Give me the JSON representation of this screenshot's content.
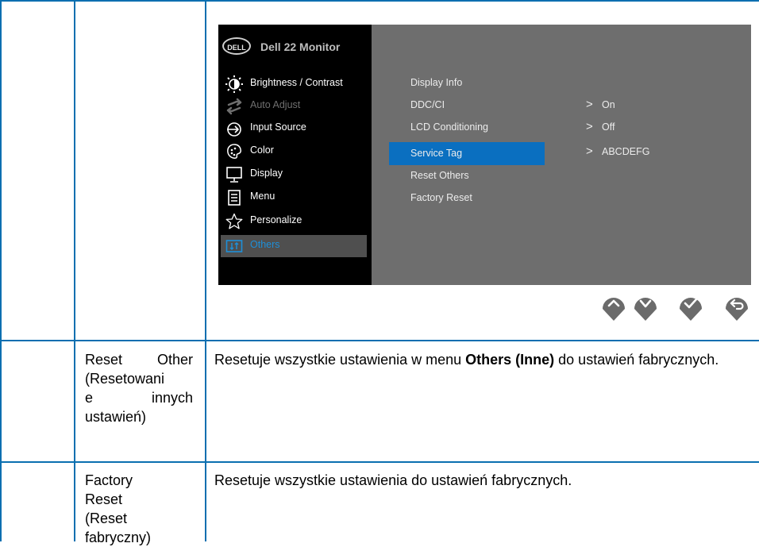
{
  "osd": {
    "logo": "DELL",
    "title": "Dell 22 Monitor",
    "menu": [
      {
        "label": "Brightness / Contrast",
        "icon": "brightness-icon"
      },
      {
        "label": "Auto Adjust",
        "icon": "auto-adjust-icon"
      },
      {
        "label": "Input Source",
        "icon": "input-source-icon"
      },
      {
        "label": "Color",
        "icon": "color-icon"
      },
      {
        "label": "Display",
        "icon": "display-icon"
      },
      {
        "label": "Menu",
        "icon": "menu-icon"
      },
      {
        "label": "Personalize",
        "icon": "star-icon"
      },
      {
        "label": "Others",
        "icon": "others-icon"
      }
    ],
    "selected_menu": "Others",
    "submenu": [
      {
        "label": "Display Info",
        "value": ""
      },
      {
        "label": "DDC/CI",
        "value": "On"
      },
      {
        "label": "LCD Conditioning",
        "value": "Off"
      },
      {
        "label": "Service Tag",
        "value": "ABCDEFG"
      },
      {
        "label": "Reset Others",
        "value": ""
      },
      {
        "label": "Factory Reset",
        "value": ""
      }
    ],
    "selected_submenu": "Service Tag",
    "arrow_glyph": ">",
    "nav_buttons": [
      "up-icon",
      "down-icon",
      "check-icon",
      "back-icon"
    ],
    "colors": {
      "highlight": "#0a6fc0",
      "selected_text": "#1e8fd8",
      "panel": "#6e6e6e",
      "button": "#6b6b6b"
    }
  },
  "rows": [
    {
      "name_lines": [
        "Reset Other",
        "(Resetowani",
        "e innych",
        "ustawień)"
      ],
      "description_parts": [
        "Resetuje wszystkie ustawienia w menu ",
        "Others (Inne)",
        " do ustawień fabrycznych."
      ]
    },
    {
      "name_lines": [
        "Factory",
        "Reset",
        "(Reset",
        "fabryczny)"
      ],
      "description": "Resetuje wszystkie ustawienia do ustawień fabrycznych."
    }
  ]
}
